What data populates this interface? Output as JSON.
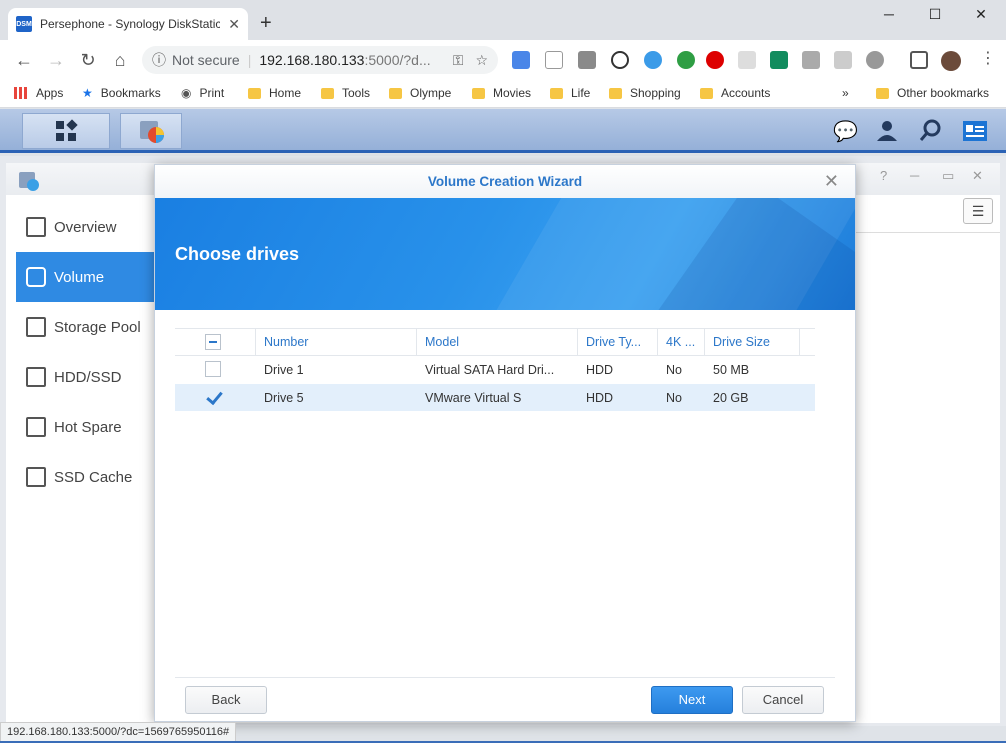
{
  "browser": {
    "tab_title": "Persephone - Synology DiskStatic",
    "tab_favicon": "DSM",
    "new_tab": "+",
    "controls": {
      "minimize": "─",
      "maximize": "☐",
      "close": "✕"
    },
    "omnibox": {
      "security": "Not secure",
      "host": "192.168.180.133",
      "path": ":5000/?d..."
    },
    "bookmarks": [
      {
        "label": "Apps",
        "icon": "apps-grid-icon"
      },
      {
        "label": "Bookmarks",
        "icon": "star-icon"
      },
      {
        "label": "Print",
        "icon": "globe-icon"
      },
      {
        "label": "Home",
        "icon": "folder-icon"
      },
      {
        "label": "Tools",
        "icon": "folder-icon"
      },
      {
        "label": "Olympe",
        "icon": "folder-icon"
      },
      {
        "label": "Movies",
        "icon": "folder-icon"
      },
      {
        "label": "Life",
        "icon": "folder-icon"
      },
      {
        "label": "Shopping",
        "icon": "folder-icon"
      },
      {
        "label": "Accounts",
        "icon": "folder-icon"
      }
    ],
    "bookmarks_overflow": "»",
    "other_bookmarks": "Other bookmarks",
    "status_url": "192.168.180.133:5000/?dc=1569765950116#"
  },
  "sidebar": {
    "items": [
      {
        "label": "Overview",
        "active": false
      },
      {
        "label": "Volume",
        "active": true
      },
      {
        "label": "Storage Pool",
        "active": false
      },
      {
        "label": "HDD/SSD",
        "active": false
      },
      {
        "label": "Hot Spare",
        "active": false
      },
      {
        "label": "SSD Cache",
        "active": false
      }
    ]
  },
  "wizard": {
    "title": "Volume Creation Wizard",
    "heading": "Choose drives",
    "columns": [
      "Number",
      "Model",
      "Drive Ty...",
      "4K ...",
      "Drive Size"
    ],
    "rows": [
      {
        "number": "Drive 1",
        "model": "Virtual SATA Hard Dri...",
        "type": "HDD",
        "k4": "No",
        "size": "50 MB",
        "checked": false
      },
      {
        "number": "Drive 5",
        "model": "VMware Virtual S",
        "type": "HDD",
        "k4": "No",
        "size": "20 GB",
        "checked": true
      }
    ],
    "buttons": {
      "back": "Back",
      "next": "Next",
      "cancel": "Cancel"
    }
  }
}
